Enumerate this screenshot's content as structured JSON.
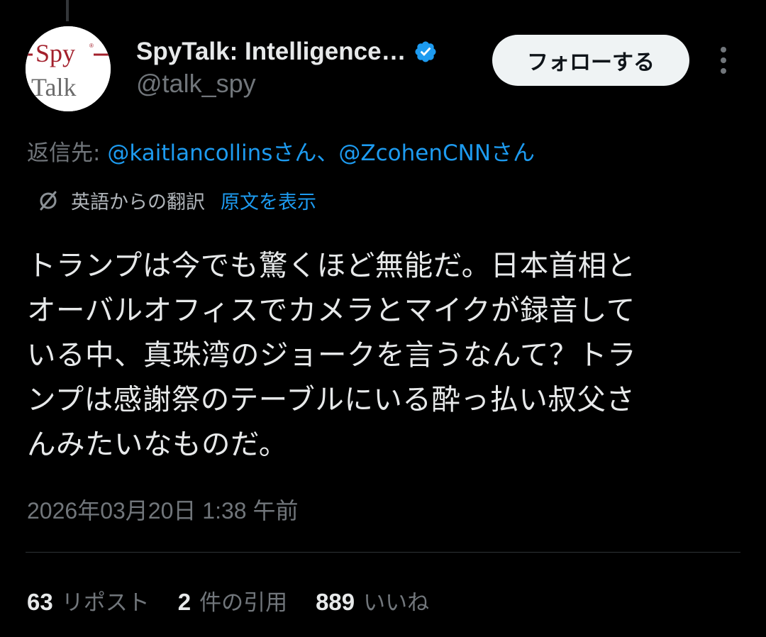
{
  "author": {
    "display_name": "SpyTalk: Intelligence…",
    "handle": "@talk_spy",
    "avatar_text_top": "Spy",
    "avatar_text_bottom": "Talk",
    "verified_icon": "verified-badge-icon",
    "verified_color": "#1d9bf0"
  },
  "header": {
    "follow_label": "フォローする",
    "more_icon": "more-vertical-icon"
  },
  "reply": {
    "prefix": "返信先: ",
    "mentions": [
      "@kaitlancollinsさん",
      "@ZcohenCNNさん"
    ],
    "separator": "、"
  },
  "translation": {
    "icon": "translate-icon",
    "label": "英語からの翻訳",
    "show_original": "原文を表示"
  },
  "tweet": {
    "lines": [
      "トランプは今でも驚くほど無能だ。日本首相と",
      "オーバルオフィスでカメラとマイクが録音して",
      "いる中、真珠湾のジョークを言うなんて？トラ",
      "ンプは感謝祭のテーブルにいる酔っ払い叔父さ",
      "んみたいなものだ。"
    ],
    "timestamp": "2026年03月20日 1:38 午前"
  },
  "stats": {
    "reposts_count": "63",
    "reposts_label": "リポスト",
    "quotes_count": "2",
    "quotes_label": "件の引用",
    "likes_count": "889",
    "likes_label": "いいね"
  },
  "colors": {
    "background": "#000000",
    "text_primary": "#e7e9ea",
    "text_secondary": "#71767b",
    "link": "#1d9bf0",
    "avatar_red": "#a3202c"
  }
}
